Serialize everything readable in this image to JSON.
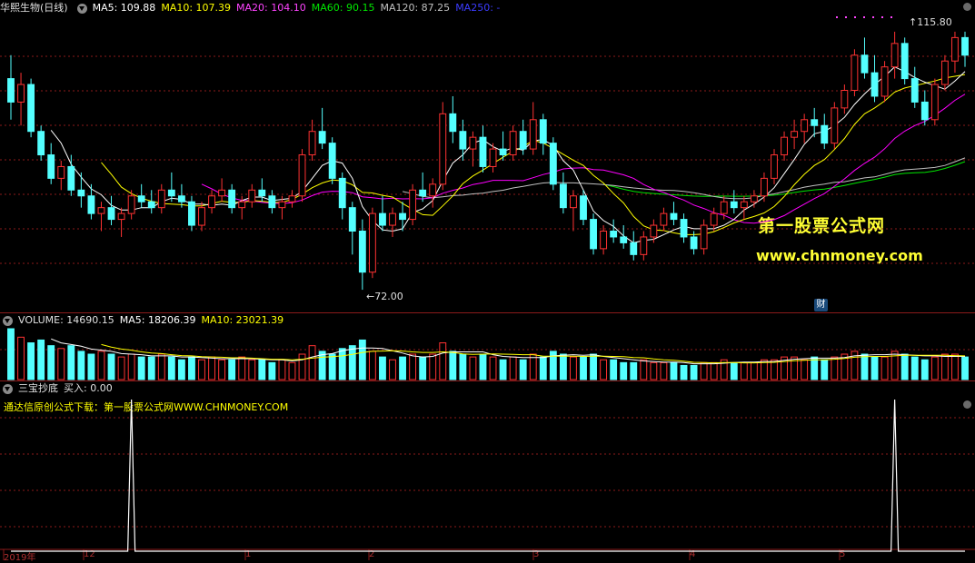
{
  "main_header": {
    "stock": "华熙生物(日线)",
    "ma5": "MA5: 109.88",
    "ma10": "MA10: 107.39",
    "ma20": "MA20: 104.10",
    "ma60": "MA60: 90.15",
    "ma120": "MA120: 87.25",
    "ma250": "MA250: -"
  },
  "volume_header": {
    "volume": "VOLUME: 14690.15",
    "ma5": "MA5: 18206.39",
    "ma10": "MA10: 23021.39"
  },
  "indicator_header": {
    "name": "三宝抄底",
    "buy": "买入: 0.00"
  },
  "indicator_note": "通达信原创公式下载：第一股票公式网WWW.CHNMONEY.COM",
  "watermark": {
    "cn": "第一股票公式网",
    "url": "www.chnmoney.com"
  },
  "price_marks": {
    "high": "115.80",
    "low": "72.00"
  },
  "cai_badge": "财",
  "x_labels": [
    "2019年",
    "12",
    "1",
    "2",
    "3",
    "4",
    "5"
  ],
  "colors": {
    "up": "#ff3232",
    "down": "#54ffff",
    "ma5": "#ffffff",
    "ma10": "#ffff00",
    "ma20": "#ff00ff",
    "ma60": "#00e600",
    "ma120": "#c0c0c0",
    "ma250": "#3c3cff",
    "grid": "#8c1a1a"
  },
  "chart_data": {
    "type": "candlestick",
    "candles": [
      [
        108,
        112,
        101,
        104
      ],
      [
        104,
        109,
        100,
        107
      ],
      [
        107,
        108,
        98,
        99
      ],
      [
        99,
        100,
        94,
        95
      ],
      [
        95,
        97,
        90,
        91
      ],
      [
        91,
        94,
        89,
        93
      ],
      [
        93,
        95,
        88,
        89
      ],
      [
        89,
        92,
        86,
        88
      ],
      [
        88,
        90,
        84,
        85
      ],
      [
        85,
        87,
        82,
        86
      ],
      [
        86,
        88,
        83,
        84
      ],
      [
        84,
        86,
        81,
        85
      ],
      [
        85,
        89,
        84,
        88
      ],
      [
        88,
        90,
        86,
        87
      ],
      [
        87,
        89,
        85,
        86
      ],
      [
        86,
        90,
        85,
        89
      ],
      [
        89,
        92,
        87,
        88
      ],
      [
        88,
        90,
        86,
        87
      ],
      [
        87,
        88,
        82,
        83
      ],
      [
        83,
        87,
        82,
        86
      ],
      [
        86,
        89,
        85,
        88
      ],
      [
        88,
        91,
        87,
        89
      ],
      [
        89,
        90,
        85,
        86
      ],
      [
        86,
        88,
        84,
        87
      ],
      [
        87,
        90,
        86,
        89
      ],
      [
        89,
        91,
        87,
        88
      ],
      [
        88,
        89,
        85,
        86
      ],
      [
        86,
        88,
        84,
        87
      ],
      [
        87,
        89,
        86,
        88
      ],
      [
        88,
        96,
        87,
        95
      ],
      [
        95,
        101,
        94,
        99
      ],
      [
        99,
        103,
        96,
        97
      ],
      [
        97,
        98,
        90,
        91
      ],
      [
        91,
        92,
        84,
        86
      ],
      [
        86,
        87,
        78,
        82
      ],
      [
        82,
        84,
        72,
        75
      ],
      [
        75,
        86,
        74,
        85
      ],
      [
        85,
        88,
        82,
        83
      ],
      [
        83,
        86,
        81,
        85
      ],
      [
        85,
        87,
        82,
        84
      ],
      [
        84,
        90,
        83,
        89
      ],
      [
        89,
        92,
        87,
        88
      ],
      [
        88,
        91,
        86,
        90
      ],
      [
        90,
        104,
        89,
        102
      ],
      [
        102,
        105,
        97,
        99
      ],
      [
        99,
        101,
        94,
        96
      ],
      [
        96,
        99,
        93,
        98
      ],
      [
        98,
        100,
        92,
        93
      ],
      [
        93,
        97,
        92,
        96
      ],
      [
        96,
        99,
        94,
        95
      ],
      [
        95,
        100,
        94,
        99
      ],
      [
        99,
        101,
        95,
        96
      ],
      [
        96,
        104,
        95,
        101
      ],
      [
        101,
        102,
        95,
        97
      ],
      [
        97,
        98,
        89,
        90
      ],
      [
        90,
        92,
        85,
        86
      ],
      [
        86,
        89,
        82,
        88
      ],
      [
        88,
        89,
        83,
        84
      ],
      [
        84,
        85,
        78,
        79
      ],
      [
        79,
        83,
        78,
        82
      ],
      [
        82,
        84,
        80,
        81
      ],
      [
        81,
        83,
        79,
        80
      ],
      [
        80,
        82,
        77,
        78
      ],
      [
        78,
        82,
        77,
        81
      ],
      [
        81,
        84,
        80,
        83
      ],
      [
        83,
        86,
        82,
        85
      ],
      [
        85,
        87,
        83,
        84
      ],
      [
        84,
        85,
        80,
        81
      ],
      [
        81,
        82,
        78,
        79
      ],
      [
        79,
        84,
        78,
        83
      ],
      [
        83,
        86,
        82,
        85
      ],
      [
        85,
        88,
        84,
        87
      ],
      [
        87,
        89,
        85,
        86
      ],
      [
        86,
        88,
        84,
        87
      ],
      [
        87,
        89,
        86,
        88
      ],
      [
        88,
        92,
        87,
        91
      ],
      [
        91,
        96,
        90,
        95
      ],
      [
        95,
        99,
        94,
        98
      ],
      [
        98,
        101,
        96,
        99
      ],
      [
        99,
        102,
        97,
        101
      ],
      [
        101,
        103,
        98,
        100
      ],
      [
        100,
        102,
        96,
        97
      ],
      [
        97,
        104,
        96,
        103
      ],
      [
        103,
        107,
        102,
        106
      ],
      [
        106,
        113,
        105,
        112
      ],
      [
        112,
        115,
        108,
        109
      ],
      [
        109,
        112,
        104,
        105
      ],
      [
        105,
        111,
        104,
        110
      ],
      [
        110,
        116,
        108,
        114
      ],
      [
        114,
        115,
        107,
        108
      ],
      [
        108,
        110,
        103,
        104
      ],
      [
        104,
        106,
        100,
        101
      ],
      [
        101,
        108,
        100,
        107
      ],
      [
        107,
        112,
        106,
        111
      ],
      [
        111,
        116,
        109,
        115
      ],
      [
        115,
        116,
        110,
        112
      ]
    ],
    "volume": [
      18,
      15,
      13,
      14,
      12,
      11,
      12,
      10,
      9,
      10,
      9,
      8,
      9,
      8,
      8,
      9,
      8,
      7,
      8,
      7,
      8,
      7,
      7,
      8,
      7,
      7,
      6,
      7,
      6,
      9,
      12,
      10,
      9,
      11,
      12,
      14,
      10,
      8,
      7,
      8,
      9,
      8,
      9,
      13,
      10,
      9,
      8,
      9,
      8,
      7,
      8,
      7,
      9,
      8,
      10,
      9,
      8,
      8,
      9,
      7,
      7,
      6,
      6,
      7,
      6,
      6,
      6,
      5,
      5,
      6,
      6,
      7,
      6,
      6,
      6,
      7,
      7,
      8,
      8,
      7,
      8,
      7,
      8,
      9,
      10,
      9,
      8,
      8,
      10,
      9,
      8,
      7,
      8,
      9,
      9,
      8
    ],
    "signals": [
      12,
      88
    ],
    "ylim": [
      70,
      118
    ]
  }
}
